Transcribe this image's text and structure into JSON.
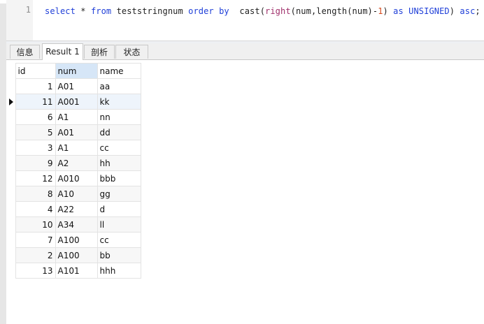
{
  "editor": {
    "line_number": "1",
    "sql_parts": {
      "select": "select",
      "star": " * ",
      "from": "from",
      "table": " teststringnum ",
      "order": "order",
      "sp1": " ",
      "by": "by",
      "sp2": "  ",
      "cast": "cast",
      "p1": "(",
      "right": "right",
      "p2": "(num,",
      "length": "length",
      "p3": "(num)-",
      "one": "1",
      "p4": ") ",
      "as": "as",
      "sp3": " ",
      "unsigned": "UNSIGNED",
      "p5": ") ",
      "asc": "asc",
      "semi": ";"
    }
  },
  "tabs": [
    "信息",
    "Result 1",
    "剖析",
    "状态"
  ],
  "active_tab": 1,
  "grid": {
    "columns": [
      "id",
      "num",
      "name"
    ],
    "rows": [
      {
        "id": "1",
        "num": "A01",
        "name": "aa"
      },
      {
        "id": "11",
        "num": "A001",
        "name": "kk"
      },
      {
        "id": "6",
        "num": "A1",
        "name": "nn"
      },
      {
        "id": "5",
        "num": "A01",
        "name": "dd"
      },
      {
        "id": "3",
        "num": "A1",
        "name": "cc"
      },
      {
        "id": "9",
        "num": "A2",
        "name": "hh"
      },
      {
        "id": "12",
        "num": "A010",
        "name": "bbb"
      },
      {
        "id": "8",
        "num": "A10",
        "name": "gg"
      },
      {
        "id": "4",
        "num": "A22",
        "name": "d"
      },
      {
        "id": "10",
        "num": "A34",
        "name": "ll"
      },
      {
        "id": "7",
        "num": "A100",
        "name": "cc"
      },
      {
        "id": "2",
        "num": "A100",
        "name": "bb"
      },
      {
        "id": "13",
        "num": "A101",
        "name": "hhh"
      }
    ],
    "current_row": 1
  },
  "colors": {
    "keyword": "#1f3fd8",
    "function": "#a0306b",
    "number": "#d5491d",
    "selected_header": "#d6e6f7"
  },
  "icons": {
    "row_indicator": "current-row-arrow-icon"
  }
}
